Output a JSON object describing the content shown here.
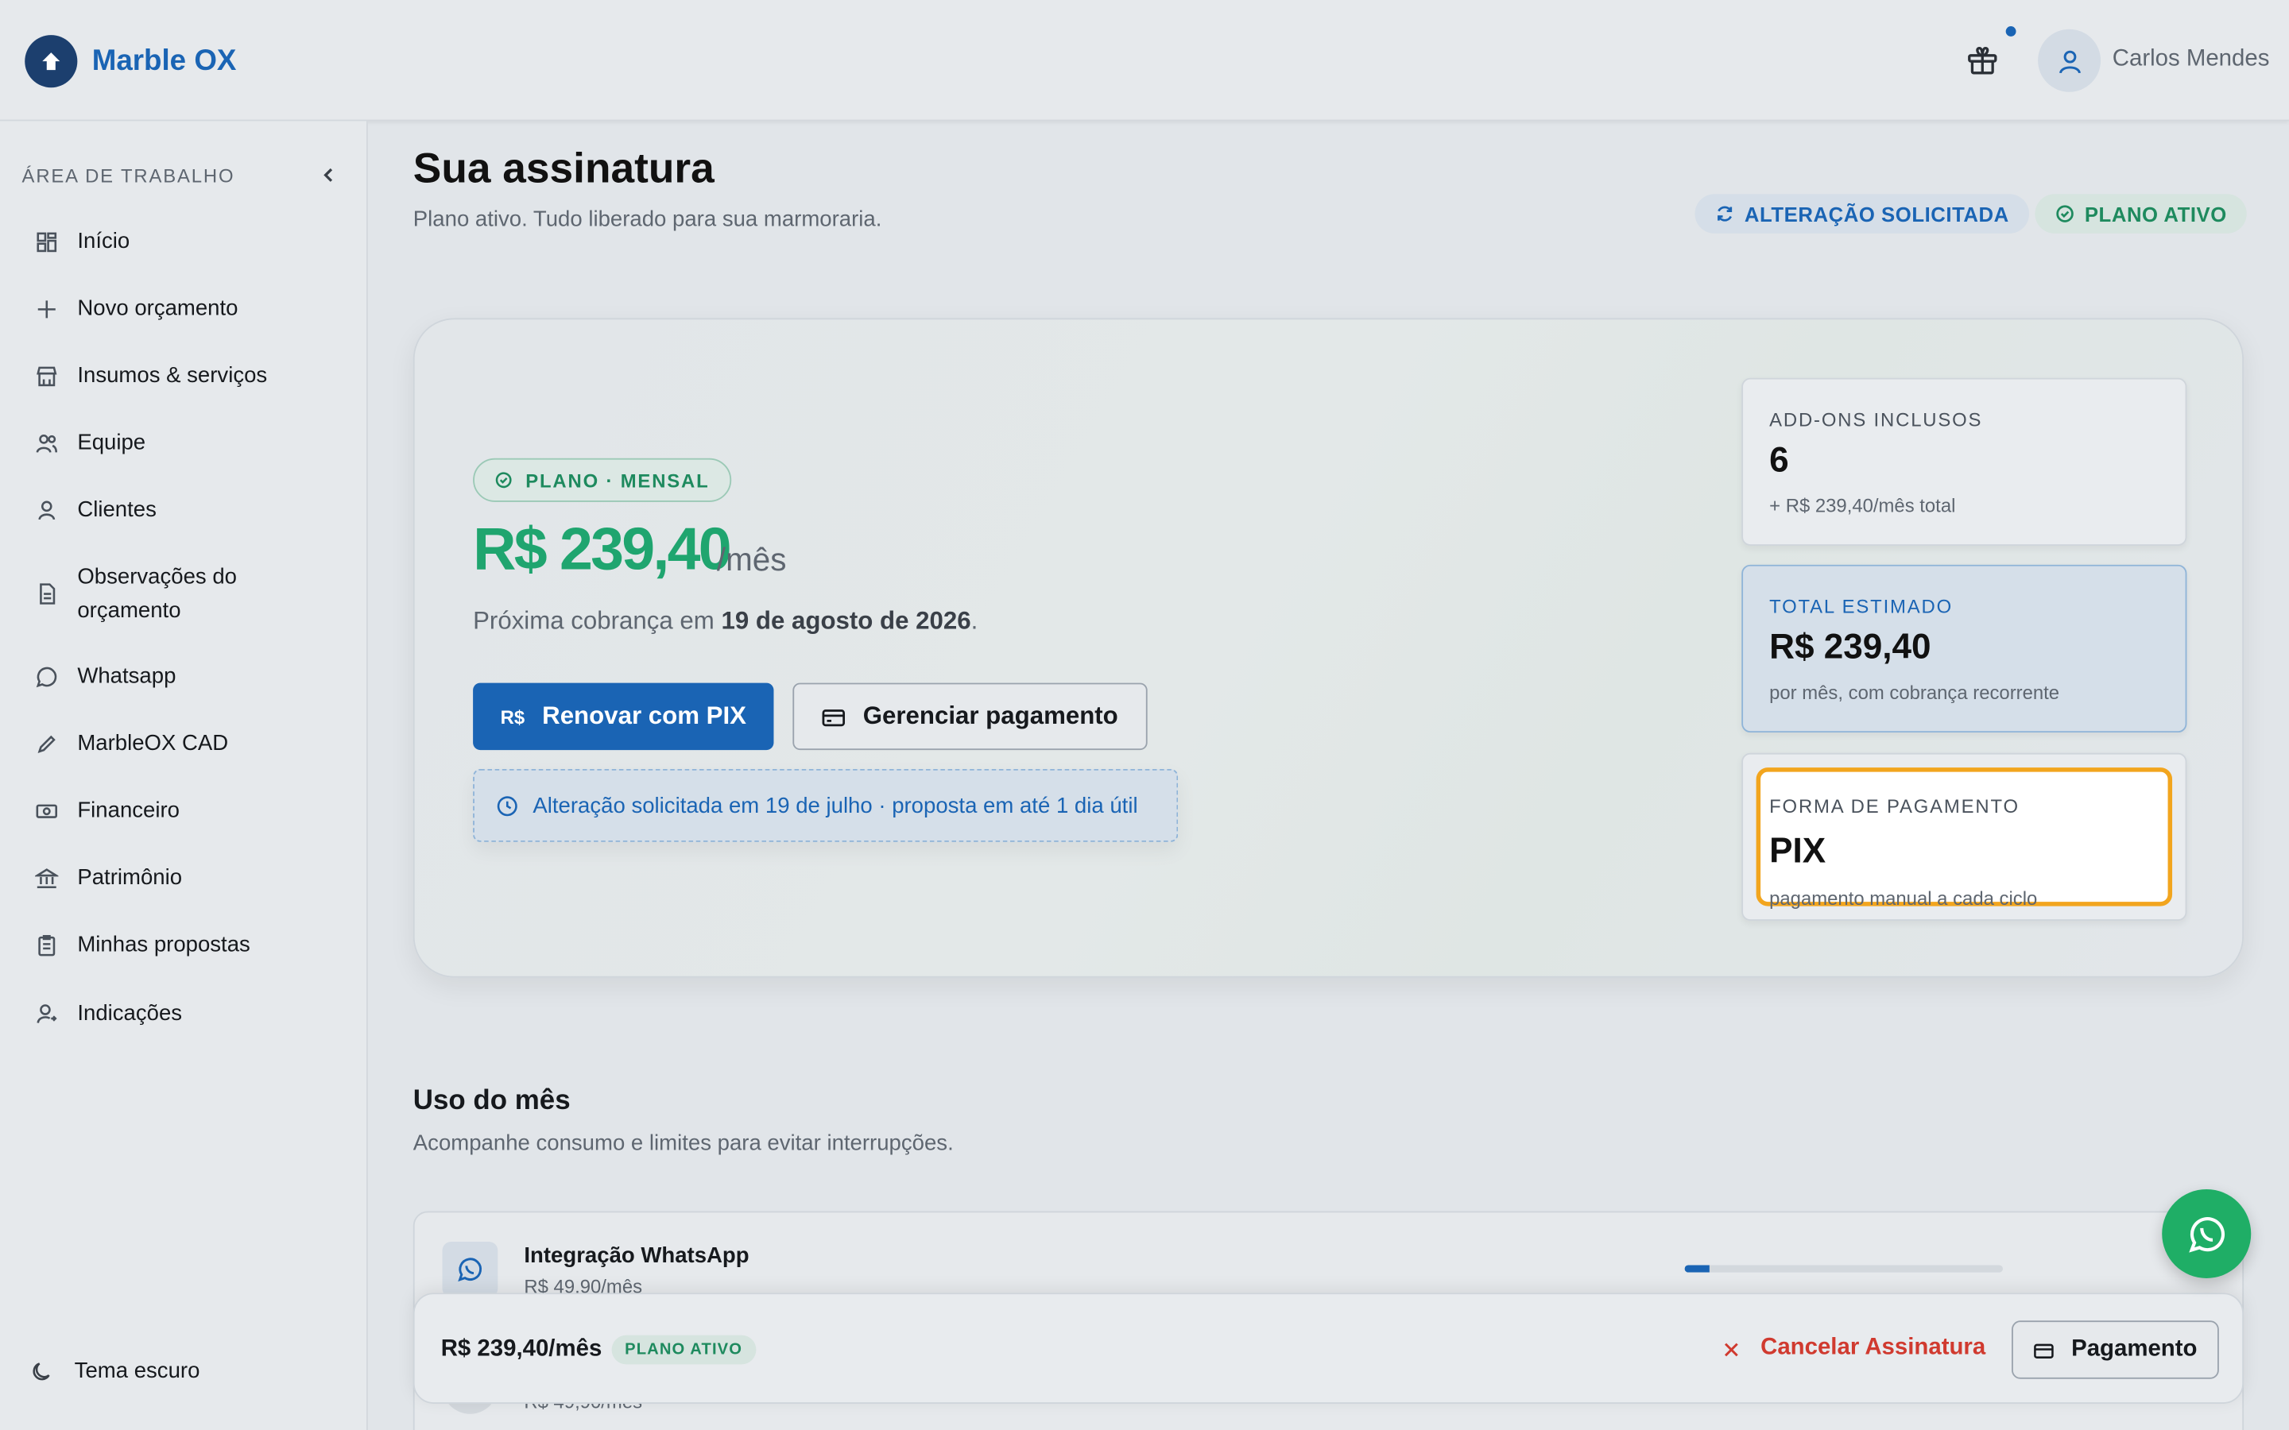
{
  "header": {
    "brand": "Marble OX",
    "user_name": "Carlos Mendes"
  },
  "sidebar": {
    "section_title": "ÁREA DE TRABALHO",
    "items": [
      {
        "label": "Início",
        "icon": "grid-icon"
      },
      {
        "label": "Novo orçamento",
        "icon": "plus-icon"
      },
      {
        "label": "Insumos & serviços",
        "icon": "store-icon"
      },
      {
        "label": "Equipe",
        "icon": "users-icon"
      },
      {
        "label": "Clientes",
        "icon": "user-icon"
      },
      {
        "label": "Observações do\norçamento",
        "icon": "file-icon"
      },
      {
        "label": "Whatsapp",
        "icon": "whatsapp-icon"
      },
      {
        "label": "MarbleOX CAD",
        "icon": "pencil-icon"
      },
      {
        "label": "Financeiro",
        "icon": "money-icon"
      },
      {
        "label": "Patrimônio",
        "icon": "bank-icon"
      },
      {
        "label": "Minhas propostas",
        "icon": "clipboard-icon"
      },
      {
        "label": "Indicações",
        "icon": "user-share-icon"
      }
    ],
    "theme_label": "Tema escuro"
  },
  "page": {
    "title": "Sua assinatura",
    "subtitle": "Plano ativo. Tudo liberado para sua marmoraria.",
    "pill_requested": "ALTERAÇÃO SOLICITADA",
    "pill_active": "PLANO ATIVO"
  },
  "hero": {
    "plan_tag": "PLANO · MENSAL",
    "price": "R$ 239,40",
    "price_unit": "/mês",
    "next_prefix": "Próxima cobrança em ",
    "next_date": "19 de agosto de 2026",
    "next_suffix": ".",
    "renew_currency": "R$",
    "renew_label": "Renovar com PIX",
    "manage_label": "Gerenciar pagamento",
    "notice": "Alteração solicitada em 19 de julho · proposta em até 1 dia útil"
  },
  "cards": {
    "addons": {
      "label": "ADD-ONS INCLUSOS",
      "value": "6",
      "sub": "+ R$ 239,40/mês total"
    },
    "total": {
      "label": "TOTAL ESTIMADO",
      "value": "R$ 239,40",
      "sub": "por mês, com cobrança recorrente"
    },
    "payment": {
      "label": "FORMA DE PAGAMENTO",
      "value": "PIX",
      "sub": "pagamento manual a cada ciclo"
    }
  },
  "usage": {
    "title": "Uso do mês",
    "subtitle": "Acompanhe consumo e limites para evitar interrupções.",
    "items": [
      {
        "name": "Integração WhatsApp",
        "price": "R$ 49,90/mês",
        "progress": 0.08
      },
      {
        "name": "",
        "price": "R$ 49,90/mês"
      }
    ]
  },
  "footer": {
    "price": "R$ 239,40/mês",
    "badge": "PLANO ATIVO",
    "cancel_label": "Cancelar Assinatura",
    "pay_label": "Pagamento"
  },
  "colors": {
    "brand": "#1a64b4",
    "success": "#1fa56f",
    "danger": "#d03a2f",
    "highlight": "#f2a51e"
  }
}
